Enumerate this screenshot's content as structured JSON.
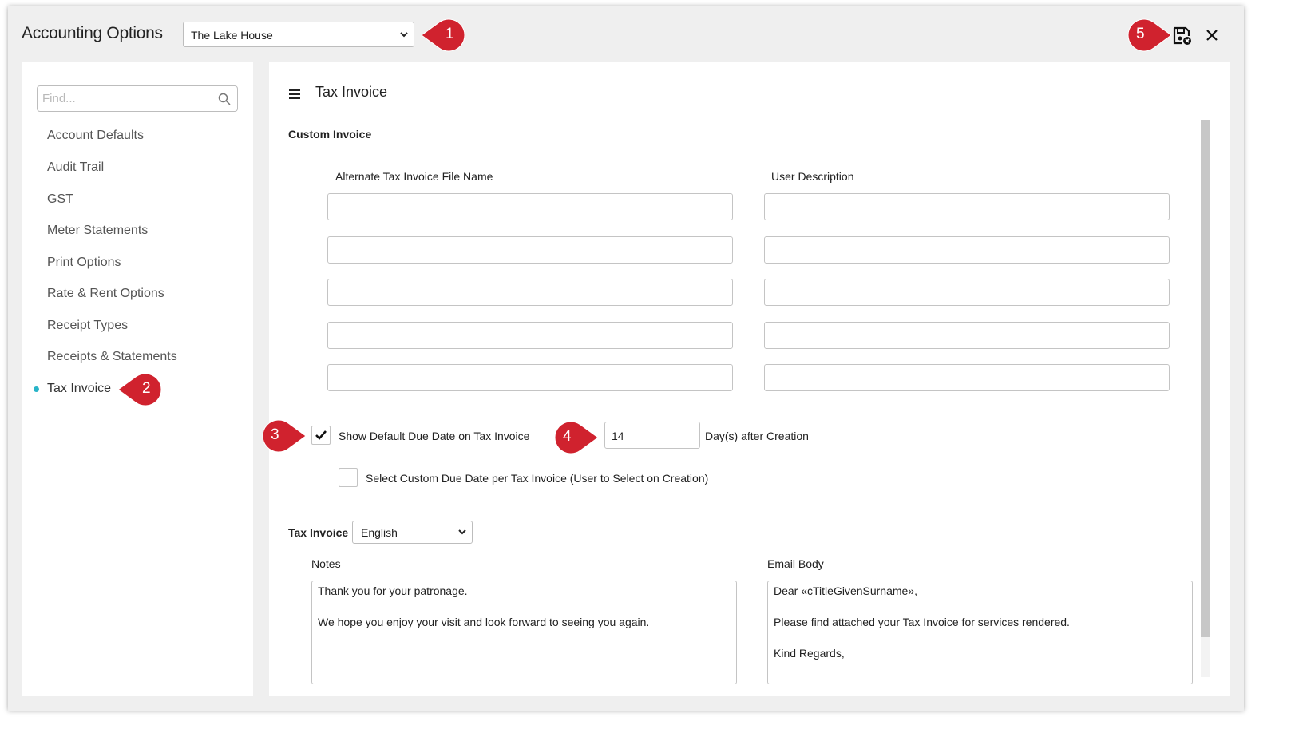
{
  "window": {
    "title": "Accounting Options",
    "property_select": {
      "value": "The Lake House"
    }
  },
  "sidebar": {
    "find_placeholder": "Find...",
    "items": [
      {
        "label": "Account Defaults"
      },
      {
        "label": "Audit Trail"
      },
      {
        "label": "GST"
      },
      {
        "label": "Meter Statements"
      },
      {
        "label": "Print Options"
      },
      {
        "label": "Rate & Rent Options"
      },
      {
        "label": "Receipt Types"
      },
      {
        "label": "Receipts & Statements"
      },
      {
        "label": "Tax Invoice",
        "active": true
      }
    ]
  },
  "main": {
    "title": "Tax Invoice",
    "custom_invoice": {
      "heading": "Custom Invoice",
      "col_file_name": "Alternate Tax Invoice File Name",
      "col_user_description": "User Description"
    },
    "due_date": {
      "show_default_label": "Show Default Due Date on Tax Invoice",
      "show_default_checked": true,
      "days_value": "14",
      "days_suffix": "Day(s) after Creation",
      "custom_label": "Select Custom Due Date per Tax Invoice (User to Select on Creation)",
      "custom_checked": false
    },
    "language": {
      "label": "Tax Invoice",
      "value": "English"
    },
    "notes": {
      "label": "Notes",
      "lines": [
        "Thank you for your patronage.",
        "We hope you enjoy your visit and look forward to seeing you again."
      ]
    },
    "email_body": {
      "label": "Email Body",
      "lines": [
        "Dear «cTitleGivenSurname»,",
        "Please find attached your Tax Invoice for services rendered.",
        "Kind Regards,"
      ]
    }
  },
  "callouts": [
    "1",
    "2",
    "3",
    "4",
    "5"
  ],
  "colors": {
    "callout": "#d0222e",
    "accent_dot": "#28b4c8"
  }
}
